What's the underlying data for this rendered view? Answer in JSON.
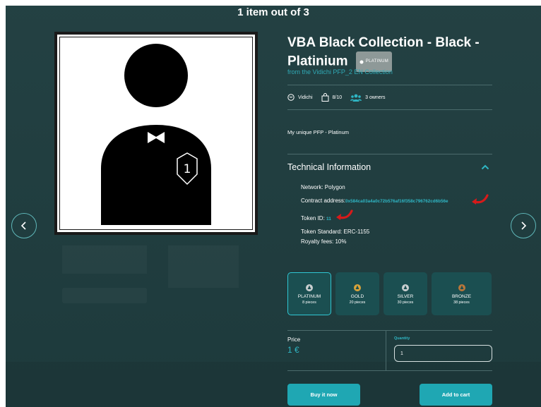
{
  "header": {
    "counter": "1 item out of 3"
  },
  "nft": {
    "title": "VBA Black Collection - Black - Platinium",
    "badge": "PLATINUM",
    "collection_text": "from the Vidichi PFP_2 EN Collection",
    "image_label": "1"
  },
  "meta": {
    "creator": "Vidichi",
    "editions": "8/10",
    "owners": "3 owners"
  },
  "description": "My unique PFP - Platinum",
  "technical": {
    "title": "Technical Information",
    "network_label": "Network: Polygon",
    "contract_label": "Contract address:",
    "contract_value": "0x584ca03a4a0c72b576af16f358c796762cd6b56e",
    "token_id_label": "Token ID:",
    "token_id_value": "11",
    "standard_label": "Token Standard: ERC-1155",
    "royalty_label": "Royalty fees: 10%"
  },
  "tiers": [
    {
      "name": "PLATINUM",
      "pieces": "8 pieces",
      "color": "#c9cfd0",
      "active": true
    },
    {
      "name": "GOLD",
      "pieces": "20 pieces",
      "color": "#d9a33a",
      "active": false
    },
    {
      "name": "SILVER",
      "pieces": "30 pieces",
      "color": "#c9cfd0",
      "active": false
    },
    {
      "name": "BRONZE",
      "pieces": "38 pieces",
      "color": "#b9763a",
      "active": false
    }
  ],
  "purchase": {
    "price_label": "Price",
    "price_value": "1 €",
    "quantity_label": "Quantity",
    "quantity_value": "1"
  },
  "buttons": {
    "buy_now": "Buy it now",
    "add_to_cart": "Add to cart"
  },
  "colors": {
    "accent": "#1fa7b3",
    "background": "#1f3d3f",
    "annotation_arrow": "#d71a1a"
  }
}
